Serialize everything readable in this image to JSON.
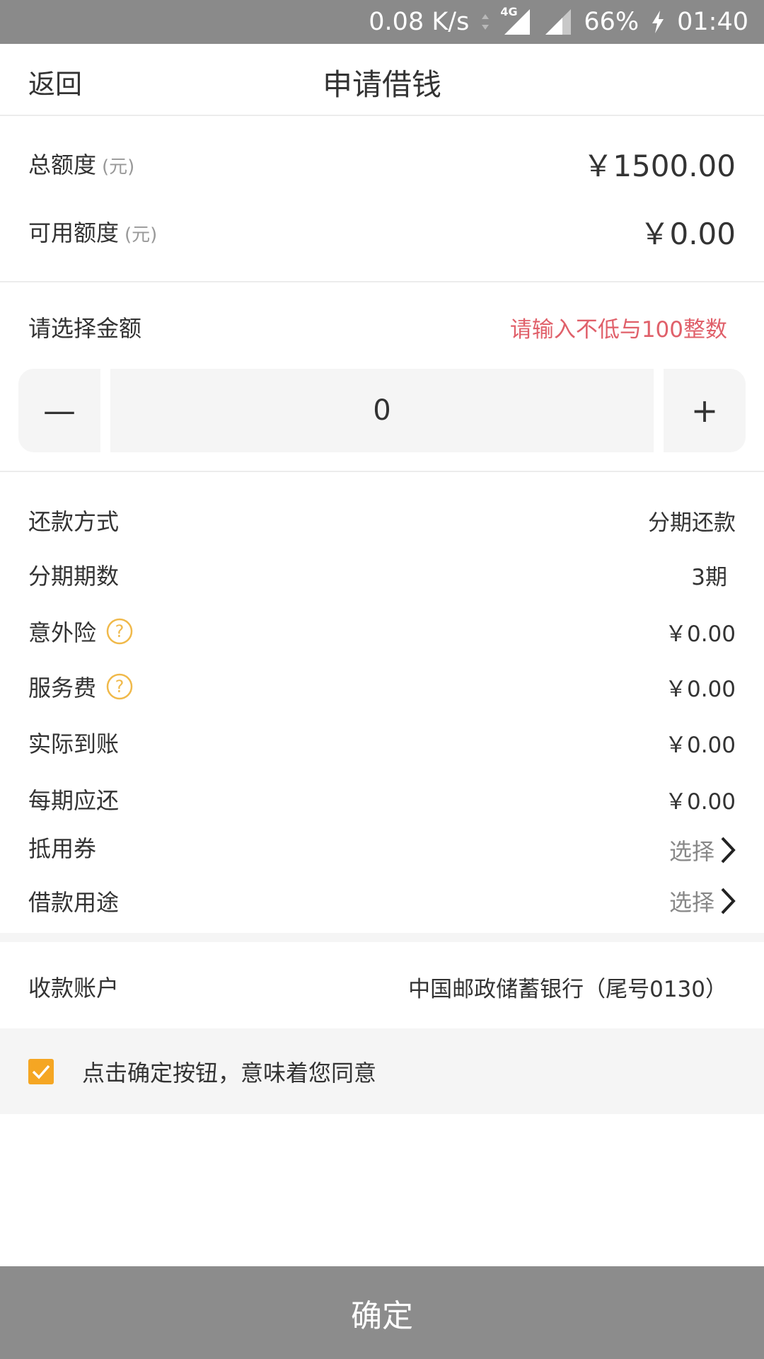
{
  "status_bar": {
    "net_speed": "0.08 K/s",
    "network": "4G",
    "battery": "66%",
    "time": "01:40"
  },
  "header": {
    "back_label": "返回",
    "title": "申请借钱"
  },
  "credit": {
    "total_label": "总额度",
    "total_unit": "(元)",
    "total_value": "￥1500.00",
    "available_label": "可用额度",
    "available_unit": "(元)",
    "available_value": "￥0.00"
  },
  "amount": {
    "label": "请选择金额",
    "hint": "请输入不低与100整数",
    "minus": "—",
    "value": "0",
    "plus": "+"
  },
  "details": {
    "repay_method_label": "还款方式",
    "repay_method_value": "分期还款",
    "periods_label": "分期期数",
    "periods_value": "3期",
    "insurance_label": "意外险",
    "insurance_value": "￥0.00",
    "service_fee_label": "服务费",
    "service_fee_value": "￥0.00",
    "actual_receive_label": "实际到账",
    "actual_receive_value": "￥0.00",
    "per_period_label": "每期应还",
    "per_period_value": "￥0.00",
    "coupon_label": "抵用券",
    "coupon_action": "选择",
    "purpose_label": "借款用途",
    "purpose_action": "选择"
  },
  "account": {
    "label": "收款账户",
    "value": "中国邮政储蓄银行（尾号0130）"
  },
  "agreement": {
    "checked": true,
    "text": "点击确定按钮，意味着您同意"
  },
  "confirm_label": "确定",
  "colors": {
    "status_bar": "#8a8a8a",
    "hint_red": "#e0606a",
    "accent_orange": "#f5a623",
    "confirm_button": "#8c8c8c"
  }
}
